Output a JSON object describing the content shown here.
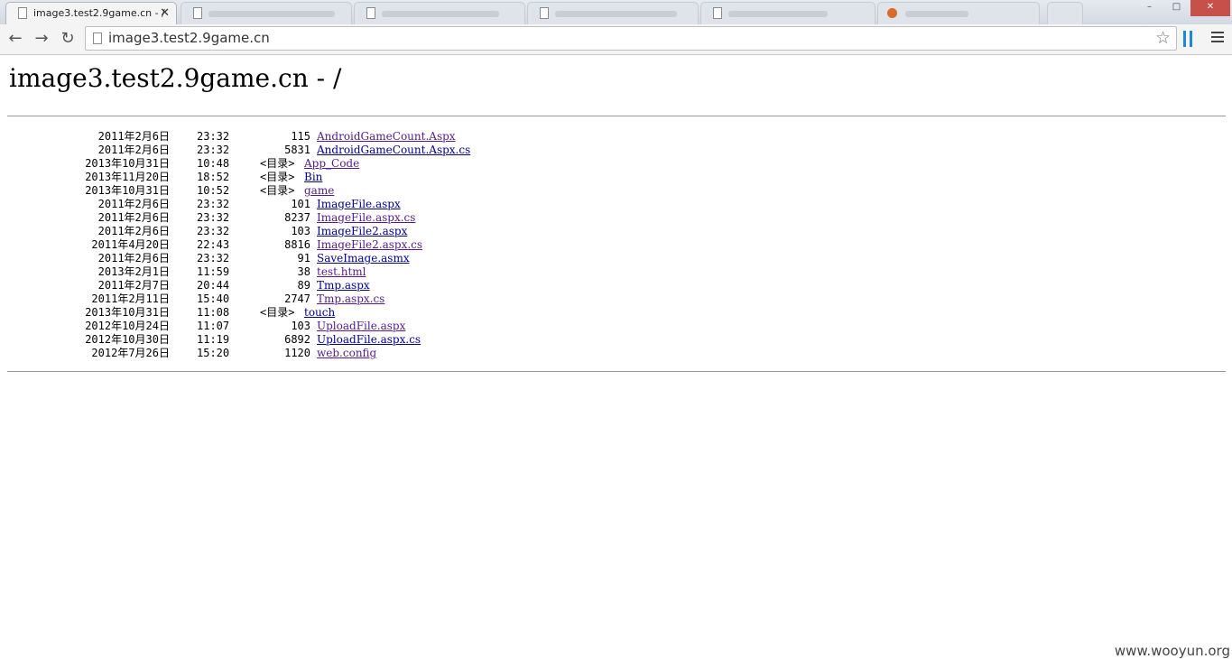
{
  "browser": {
    "active_tab_title": "image3.test2.9game.cn - /",
    "tab_close": "✕",
    "address": "image3.test2.9game.cn"
  },
  "page": {
    "heading": "image3.test2.9game.cn - /",
    "entries": [
      {
        "date": "2011年2月6日",
        "time": "23:32",
        "size": "115",
        "dir": "",
        "name": "AndroidGameCount.Aspx"
      },
      {
        "date": "2011年2月6日",
        "time": "23:32",
        "size": "5831",
        "dir": "",
        "name": "AndroidGameCount.Aspx.cs"
      },
      {
        "date": "2013年10月31日",
        "time": "10:48",
        "size": "",
        "dir": "<目录>",
        "name": "App_Code"
      },
      {
        "date": "2013年11月20日",
        "time": "18:52",
        "size": "",
        "dir": "<目录>",
        "name": "Bin"
      },
      {
        "date": "2013年10月31日",
        "time": "10:52",
        "size": "",
        "dir": "<目录>",
        "name": "game"
      },
      {
        "date": "2011年2月6日",
        "time": "23:32",
        "size": "101",
        "dir": "",
        "name": "ImageFile.aspx"
      },
      {
        "date": "2011年2月6日",
        "time": "23:32",
        "size": "8237",
        "dir": "",
        "name": "ImageFile.aspx.cs"
      },
      {
        "date": "2011年2月6日",
        "time": "23:32",
        "size": "103",
        "dir": "",
        "name": "ImageFile2.aspx"
      },
      {
        "date": "2011年4月20日",
        "time": "22:43",
        "size": "8816",
        "dir": "",
        "name": "ImageFile2.aspx.cs"
      },
      {
        "date": "2011年2月6日",
        "time": "23:32",
        "size": "91",
        "dir": "",
        "name": "SaveImage.asmx"
      },
      {
        "date": "2013年2月1日",
        "time": "11:59",
        "size": "38",
        "dir": "",
        "name": "test.html"
      },
      {
        "date": "2011年2月7日",
        "time": "20:44",
        "size": "89",
        "dir": "",
        "name": "Tmp.aspx"
      },
      {
        "date": "2011年2月11日",
        "time": "15:40",
        "size": "2747",
        "dir": "",
        "name": "Tmp.aspx.cs"
      },
      {
        "date": "2013年10月31日",
        "time": "11:08",
        "size": "",
        "dir": "<目录>",
        "name": "touch"
      },
      {
        "date": "2012年10月24日",
        "time": "11:07",
        "size": "103",
        "dir": "",
        "name": "UploadFile.aspx"
      },
      {
        "date": "2012年10月30日",
        "time": "11:19",
        "size": "6892",
        "dir": "",
        "name": "UploadFile.aspx.cs"
      },
      {
        "date": "2012年7月26日",
        "time": "15:20",
        "size": "1120",
        "dir": "",
        "name": "web.config"
      }
    ]
  },
  "watermark": "www.wooyun.org"
}
